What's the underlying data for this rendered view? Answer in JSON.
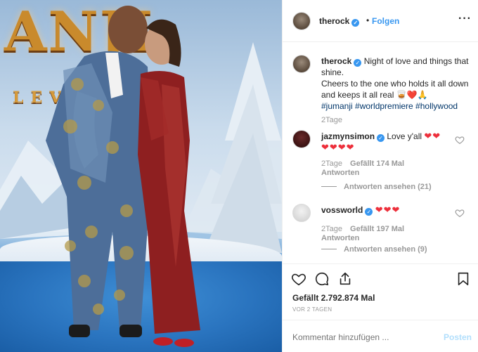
{
  "photo": {
    "title_text": "ANJI",
    "subtitle_text": "LEVE"
  },
  "header": {
    "username": "therock",
    "follow_label": "Folgen",
    "more_label": "···"
  },
  "caption": {
    "username": "therock",
    "line1": "Night of love and things that shine.",
    "line2": "Cheers to the one who holds it all down and keeps it all real",
    "emoji": "🥃❤️🙏",
    "hashtags": "#jumanji #worldpremiere #hollywood",
    "time": "2Tage"
  },
  "comments": [
    {
      "username": "jazmynsimon",
      "text": "Love y'all",
      "hearts_inline": "❤❤",
      "hearts_line2": "❤❤❤❤",
      "time": "2Tage",
      "likes": "Gefällt 174 Mal",
      "reply_label": "Antworten",
      "view_replies": "Antworten ansehen (21)"
    },
    {
      "username": "vossworld",
      "text": "",
      "hearts_inline": "❤❤❤",
      "time": "2Tage",
      "likes": "Gefällt 197 Mal",
      "reply_label": "Antworten",
      "view_replies": "Antworten ansehen (9)"
    }
  ],
  "actions": {
    "likes_total": "Gefällt 2.792.874 Mal",
    "post_date": "VOR 2 TAGEN"
  },
  "comment_box": {
    "placeholder": "Kommentar hinzufügen ...",
    "post_label": "Posten"
  },
  "colors": {
    "link_blue": "#3897f0",
    "heart_red": "#ed2f3b",
    "hashtag": "#003569"
  }
}
